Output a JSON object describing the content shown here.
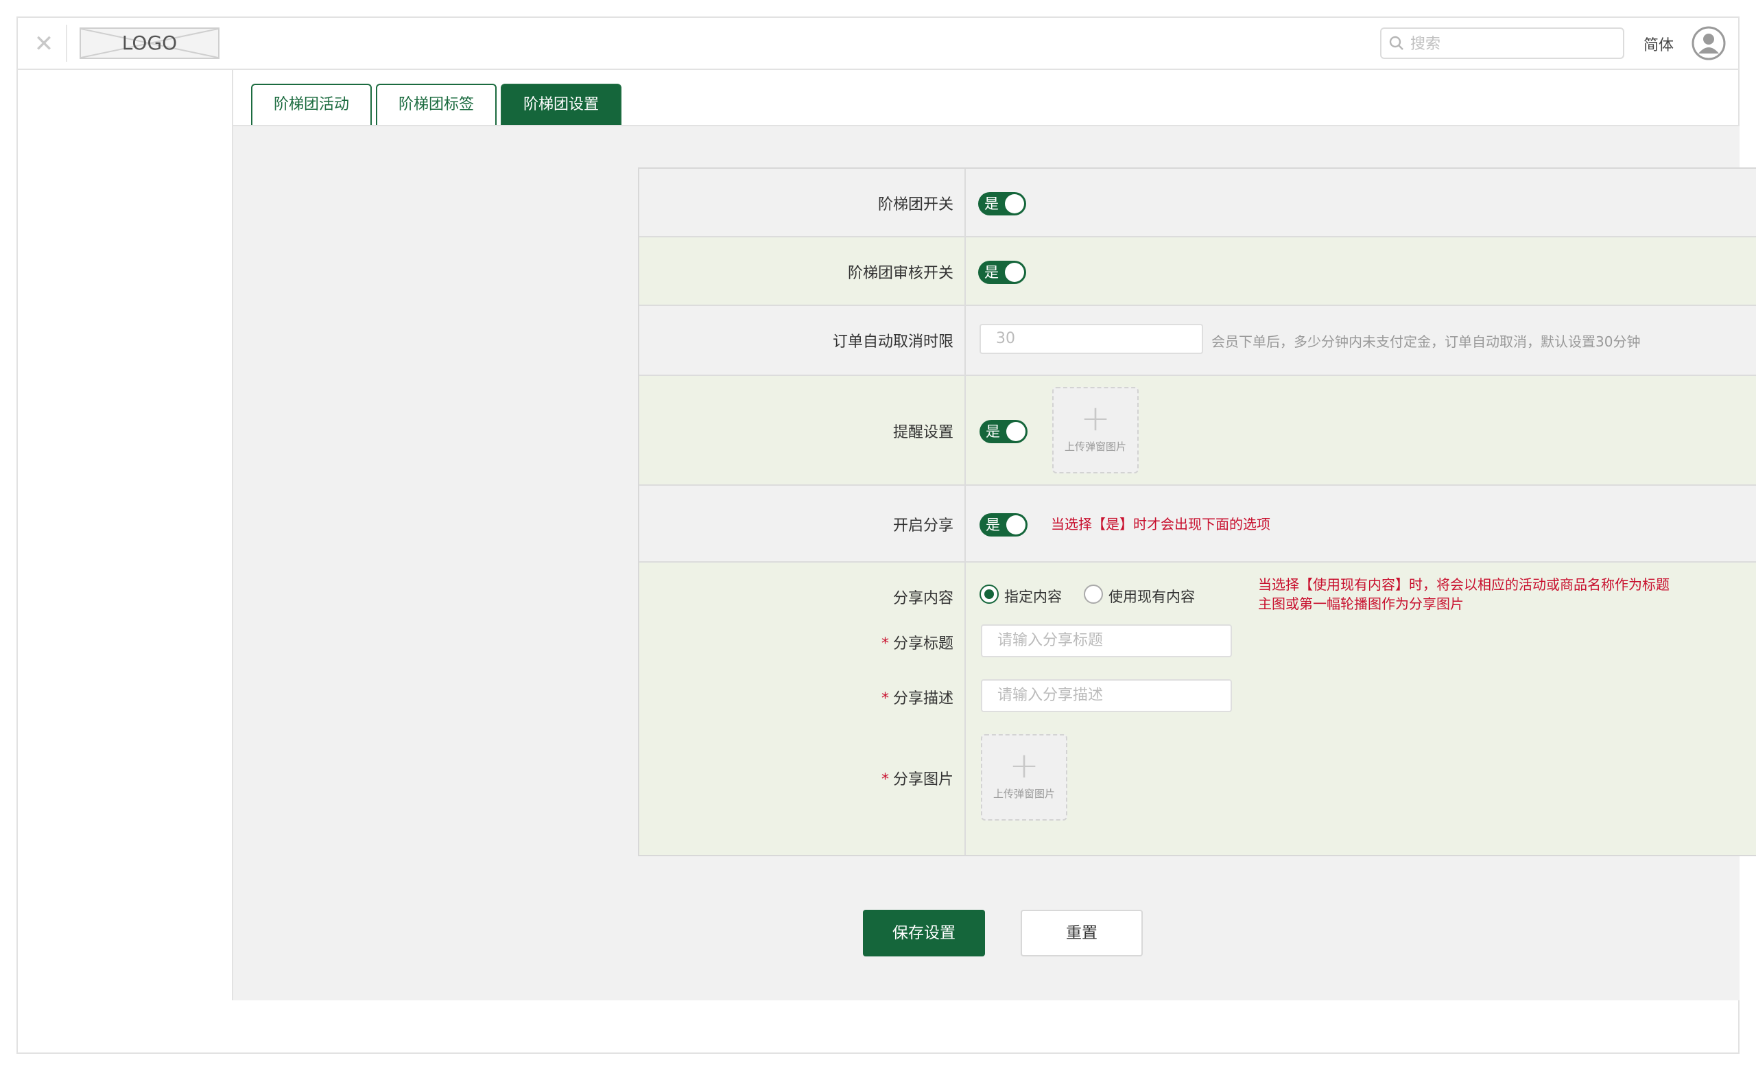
{
  "header": {
    "logo_text": "LOGO",
    "search_placeholder": "搜索",
    "language": "简体"
  },
  "tabs": [
    {
      "label": "阶梯团活动",
      "active": false
    },
    {
      "label": "阶梯团标签",
      "active": false
    },
    {
      "label": "阶梯团设置",
      "active": true
    }
  ],
  "form": {
    "group_switch": {
      "label": "阶梯团开关",
      "value": "是",
      "on": true
    },
    "review_switch": {
      "label": "阶梯团审核开关",
      "value": "是",
      "on": true
    },
    "auto_cancel": {
      "label": "订单自动取消时限",
      "placeholder": "30",
      "hint": "会员下单后，多少分钟内未支付定金，订单自动取消，默认设置30分钟"
    },
    "reminder": {
      "label": "提醒设置",
      "value": "是",
      "on": true,
      "upload_caption": "上传弹窗图片"
    },
    "share_enable": {
      "label": "开启分享",
      "value": "是",
      "on": true,
      "note": "当选择【是】时才会出现下面的选项"
    },
    "share_content": {
      "label": "分享内容",
      "options": [
        "指定内容",
        "使用现有内容"
      ],
      "selected": "指定内容",
      "note_line1": "当选择【使用现有内容】时，将会以相应的活动或商品名称作为标题",
      "note_line2": "主图或第一幅轮播图作为分享图片"
    },
    "share_title": {
      "required_mark": "*",
      "label": "分享标题",
      "placeholder": "请输入分享标题"
    },
    "share_desc": {
      "required_mark": "*",
      "label": "分享描述",
      "placeholder": "请输入分享描述"
    },
    "share_image": {
      "required_mark": "*",
      "label": "分享图片",
      "upload_caption": "上传弹窗图片"
    }
  },
  "actions": {
    "save": "保存设置",
    "reset": "重置"
  },
  "colors": {
    "primary": "#15663b",
    "alert": "#c8102e",
    "row_alt": "#eef2e6",
    "row_plain": "#f1f1f1"
  }
}
